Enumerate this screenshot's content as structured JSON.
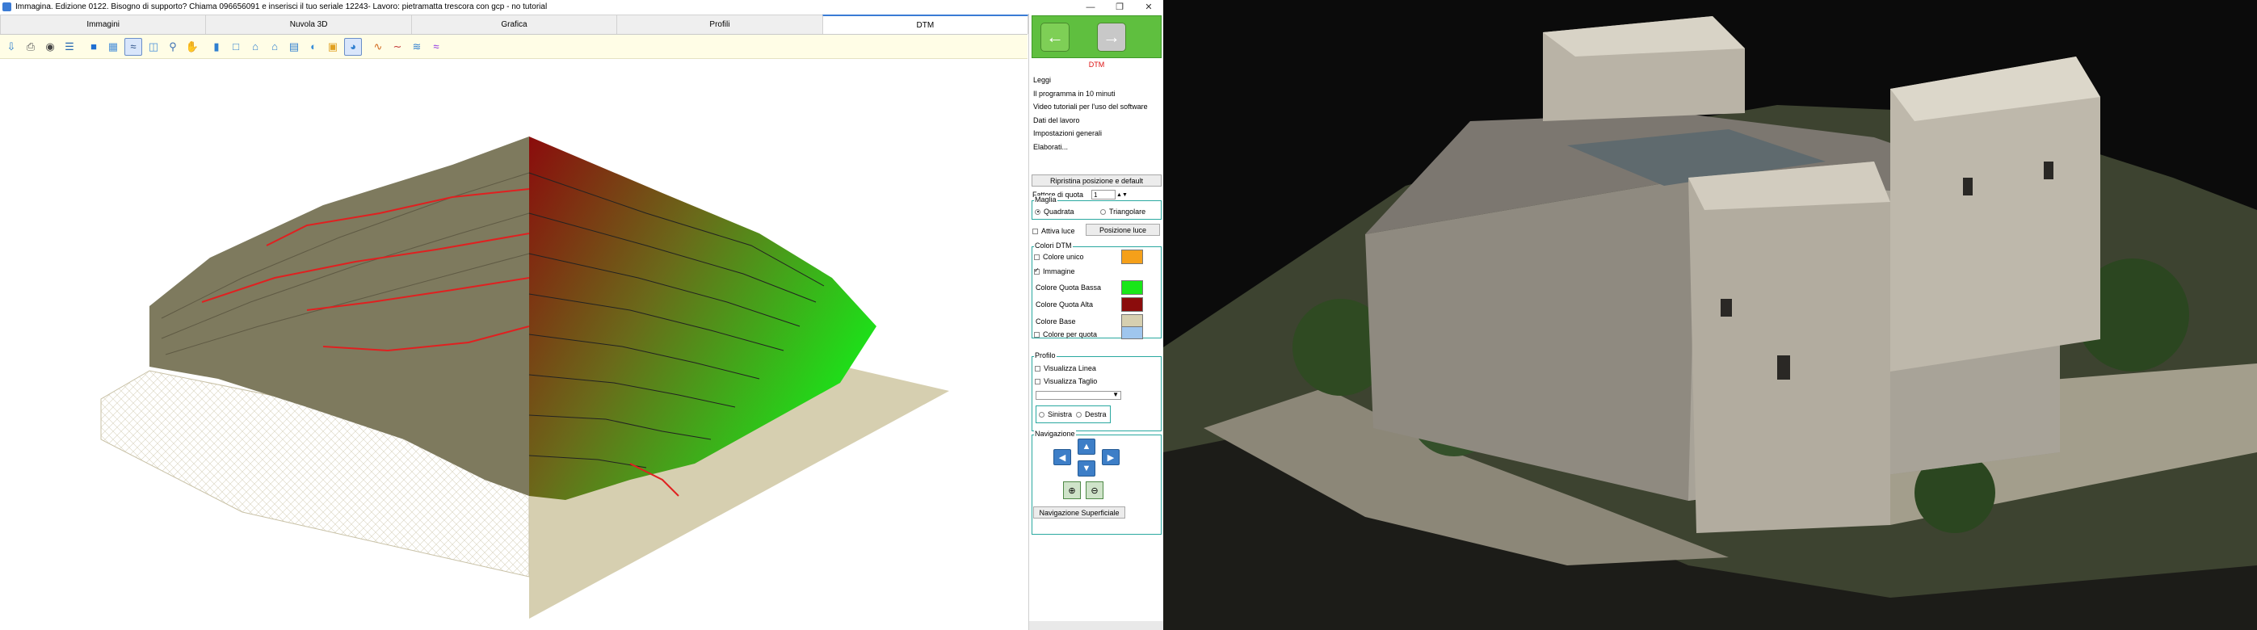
{
  "window": {
    "title": "Immagina. Edizione 0122. Bisogno di supporto? Chiama 096656091 e inserisci il tuo seriale 12243- Lavoro: pietramatta trescora con gcp - no tutorial",
    "minimize_icon": "minimize-icon",
    "maximize_icon": "maximize-icon",
    "close_icon": "close-icon"
  },
  "tabs": [
    {
      "label": "Immagini",
      "active": false
    },
    {
      "label": "Nuvola 3D",
      "active": false
    },
    {
      "label": "Grafica",
      "active": false
    },
    {
      "label": "Profili",
      "active": false
    },
    {
      "label": "DTM",
      "active": true
    }
  ],
  "toolbar_icons": [
    "import-icon",
    "print-icon",
    "camera-icon",
    "measure-icon",
    "cube-icon",
    "grid-icon",
    "surface-icon",
    "layers-icon",
    "zoom-icon",
    "hand-icon",
    "columns-icon",
    "frame-icon",
    "home-icon",
    "home-outline-icon",
    "layout-icon",
    "palette-icon",
    "folder-icon",
    "globe-icon",
    "curve-icon",
    "wave-icon",
    "contour-icon",
    "profile-icon"
  ],
  "sidebar": {
    "nav": {
      "back_icon": "arrow-left-icon",
      "forward_icon": "arrow-right-icon",
      "accent": "#5fbf3f"
    },
    "section_title": "DTM",
    "menu_items": [
      "Leggi",
      "Il programma in 10 minuti",
      "Video tutoriali per l'uso del software",
      "Dati del lavoro",
      "Impostazioni generali",
      "Elaborati..."
    ],
    "reset_button": "Ripristina posizione e default",
    "quota_label": "Fattore di quota",
    "quota_value": "1",
    "maglia": {
      "title": "Maglia",
      "option1": "Quadrata",
      "option2": "Triangolare"
    },
    "luce": {
      "checkbox": "Attiva luce",
      "button": "Posizione luce"
    },
    "colori": {
      "title": "Colori DTM",
      "items": [
        {
          "label": "Colore unico",
          "checked": false,
          "color": "#f5a01a"
        },
        {
          "label": "Immagine",
          "checked": true
        },
        {
          "label": "Colore Quota Bassa",
          "color": "#19e619"
        },
        {
          "label": "Colore Quota Alta",
          "color": "#8b0c0c"
        },
        {
          "label": "Colore Base",
          "color": "#d6cfb0"
        },
        {
          "label": "Colore per quota",
          "checked": false
        }
      ]
    },
    "profilo": {
      "title": "Profilo",
      "line": "Visualizza Linea",
      "cut": "Visualizza Taglio",
      "left": "Sinistra",
      "right": "Destra"
    },
    "navigazione": {
      "title": "Navigazione",
      "button": "Navigazione Superficiale"
    }
  }
}
